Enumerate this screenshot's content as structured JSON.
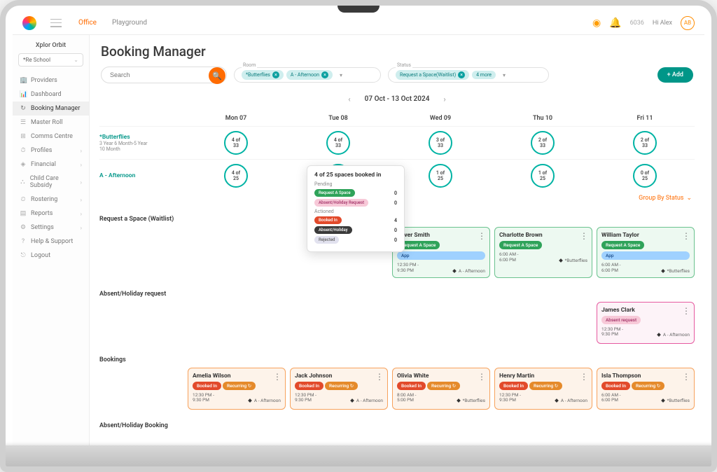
{
  "brand": "Xplor Orbit",
  "topnav": {
    "office": "Office",
    "playground": "Playground"
  },
  "topbar": {
    "count": "6036",
    "greeting": "Hi Alex",
    "initials": "AB"
  },
  "sidebar": {
    "center": "*Re School",
    "items": [
      {
        "label": "Providers",
        "icon": "🏢"
      },
      {
        "label": "Dashboard",
        "icon": "📊"
      },
      {
        "label": "Booking Manager",
        "icon": "↻",
        "active": true
      },
      {
        "label": "Master Roll",
        "icon": "☰"
      },
      {
        "label": "Comms Centre",
        "icon": "⊞"
      },
      {
        "label": "Profiles",
        "icon": "⏱",
        "expand": true
      },
      {
        "label": "Financial",
        "icon": "◈",
        "expand": true
      },
      {
        "label": "Child Care Subsidy",
        "icon": "⛬",
        "expand": true
      },
      {
        "label": "Rostering",
        "icon": "⏲",
        "expand": true
      },
      {
        "label": "Reports",
        "icon": "▤",
        "expand": true
      },
      {
        "label": "Settings",
        "icon": "⚙",
        "expand": true
      },
      {
        "label": "Help & Support",
        "icon": "?"
      },
      {
        "label": "Logout",
        "icon": "⎋"
      }
    ]
  },
  "page": {
    "title": "Booking Manager",
    "search_placeholder": "Search"
  },
  "filters": {
    "room_label": "Room",
    "room_chips": [
      "*Butterflies",
      "A - Afternoon"
    ],
    "status_label": "Status",
    "status_chips": [
      "Request a Space(Waitlist)",
      "4 more"
    ],
    "add": "+ Add"
  },
  "dates": {
    "range": "07 Oct - 13 Oct 2024",
    "days": [
      "Mon 07",
      "Tue 08",
      "Wed 09",
      "Thu 10",
      "Fri 11"
    ]
  },
  "rooms": [
    {
      "name": "*Butterflies",
      "sub1": "3 Year 6 Month-5 Year",
      "sub2": "10 Month",
      "capacity": [
        {
          "t": "4 of",
          "b": "33"
        },
        {
          "t": "4 of",
          "b": "33"
        },
        {
          "t": "3 of",
          "b": "33"
        },
        {
          "t": "2 of",
          "b": "33"
        },
        {
          "t": "2 of",
          "b": "33"
        }
      ]
    },
    {
      "name": "A - Afternoon",
      "capacity": [
        {
          "t": "4 of",
          "b": "25"
        },
        {
          "t": "4 of",
          "b": "25"
        },
        {
          "t": "1 of",
          "b": "25"
        },
        {
          "t": "1 of",
          "b": "25"
        },
        {
          "t": "0 of",
          "b": "25"
        }
      ]
    }
  ],
  "group_by": "Group By Status",
  "popover": {
    "title": "4 of 25 spaces booked in",
    "pending_label": "Pending",
    "actioned_label": "Actioned",
    "rows": [
      {
        "badge": "Request A Space",
        "cls": "green",
        "n": "0"
      },
      {
        "badge": "Absent/Holiday Request",
        "cls": "pink",
        "n": "0"
      }
    ],
    "rows2": [
      {
        "badge": "Booked In",
        "cls": "red",
        "n": "4"
      },
      {
        "badge": "Absent/Holiday",
        "cls": "dark",
        "n": "0"
      },
      {
        "badge": "Rejected",
        "cls": "grey",
        "n": "0"
      }
    ]
  },
  "sections": {
    "request": {
      "label": "Request a Space (Waitlist)",
      "cards": [
        null,
        null,
        {
          "name": "Oliver Smith",
          "pills": [
            {
              "t": "Request A Space",
              "c": "request"
            },
            {
              "t": "App",
              "c": "app"
            }
          ],
          "time": "12:30 PM -\n9:30 PM",
          "room": "A - Afternoon"
        },
        {
          "name": "Charlotte Brown",
          "pills": [
            {
              "t": "Request A Space",
              "c": "request"
            }
          ],
          "time": "6:00 AM -\n6:00 PM",
          "room": "*Butterflies"
        },
        {
          "name": "William Taylor",
          "pills": [
            {
              "t": "Request A Space",
              "c": "request"
            },
            {
              "t": "App",
              "c": "app"
            }
          ],
          "time": "6:00 AM -\n6:00 PM",
          "room": "*Butterflies"
        }
      ]
    },
    "absent_request": {
      "label": "Absent/Holiday request",
      "cards": [
        null,
        null,
        null,
        null,
        {
          "name": "James Clark",
          "pills": [
            {
              "t": "Absent request",
              "c": "absent"
            }
          ],
          "time": "12:30 PM -\n9:30 PM",
          "room": "A - Afternoon",
          "cls": "pink"
        }
      ]
    },
    "bookings": {
      "label": "Bookings",
      "cards": [
        {
          "name": "Amelia Wilson",
          "pills": [
            {
              "t": "Booked In",
              "c": "booked"
            },
            {
              "t": "Recurring ↻",
              "c": "recurring"
            }
          ],
          "time": "12:30 PM -\n9:30 PM",
          "room": "A - Afternoon"
        },
        {
          "name": "Jack Johnson",
          "pills": [
            {
              "t": "Booked In",
              "c": "booked"
            },
            {
              "t": "Recurring ↻",
              "c": "recurring"
            }
          ],
          "time": "12:30 PM -\n9:30 PM",
          "room": "A - Afternoon"
        },
        {
          "name": "Olivia White",
          "pills": [
            {
              "t": "Booked In",
              "c": "booked"
            },
            {
              "t": "Recurring ↻",
              "c": "recurring"
            }
          ],
          "time": "8:00 AM -\n5:00 PM",
          "room": "*Butterflies"
        },
        {
          "name": "Henry Martin",
          "pills": [
            {
              "t": "Booked In",
              "c": "booked"
            },
            {
              "t": "Recurring ↻",
              "c": "recurring"
            }
          ],
          "time": "12:30 PM -\n9:30 PM",
          "room": "A - Afternoon"
        },
        {
          "name": "Isla Thompson",
          "pills": [
            {
              "t": "Booked In",
              "c": "booked"
            },
            {
              "t": "Recurring ↻",
              "c": "recurring"
            }
          ],
          "time": "6:00 AM -\n6:00 PM",
          "room": "*Butterflies"
        }
      ]
    },
    "absent_booking": {
      "label": "Absent/Holiday Booking"
    }
  }
}
